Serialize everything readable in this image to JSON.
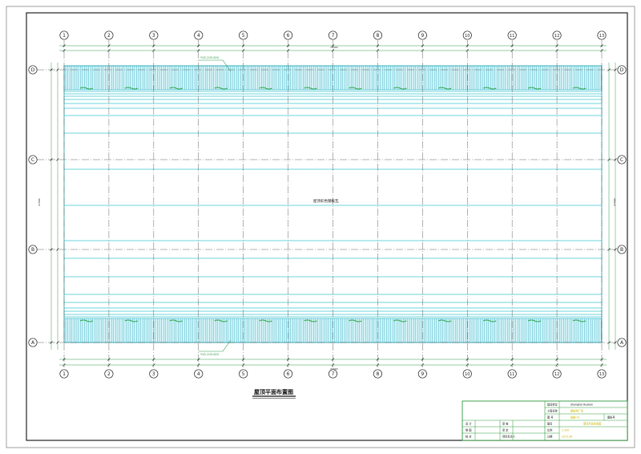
{
  "drawing": {
    "title": "屋顶平面布置图",
    "center_note": "屋顶彩色钢板瓦",
    "callout_top": "YX5-205-820",
    "callout_bottom": "YX5-205-820",
    "dim_total_horizontal": "72000",
    "dim_total_vertical": "27000",
    "grid_columns": [
      "1",
      "2",
      "3",
      "4",
      "5",
      "6",
      "7",
      "8",
      "9",
      "10",
      "11",
      "12",
      "13"
    ],
    "grid_rows": [
      "D",
      "C",
      "B",
      "A"
    ],
    "colors": {
      "frame": "#222222",
      "axis": "#555555",
      "cyan": "#29b4c8",
      "purlin": "#3ec7d0",
      "green_mark": "#2fa84a",
      "dim": "#2e9a4a",
      "title_block_green": "#2e9a3a",
      "title_block_yellow": "#c8b400"
    }
  },
  "title_block": {
    "r1_c1": "建设单位",
    "r1_c2": "Shanghai Hualian",
    "r2_c1": "工程名称",
    "r2_c2": "钢结构厂房",
    "r3_c1": "图  号",
    "r3_c2": "结施-01",
    "r3_c3": "图纸号",
    "left_rows": [
      {
        "a": "设 计",
        "b": "审 核"
      },
      {
        "a": "制 图",
        "b": "审 定"
      },
      {
        "a": "校 对",
        "b": "项目负责人"
      }
    ],
    "mid_rows": [
      {
        "a": "图名",
        "b": ""
      },
      {
        "a": "比例",
        "b": "1:100"
      },
      {
        "a": "日期",
        "b": "2015.06"
      }
    ],
    "drawing_name": "屋顶平面布置图"
  }
}
